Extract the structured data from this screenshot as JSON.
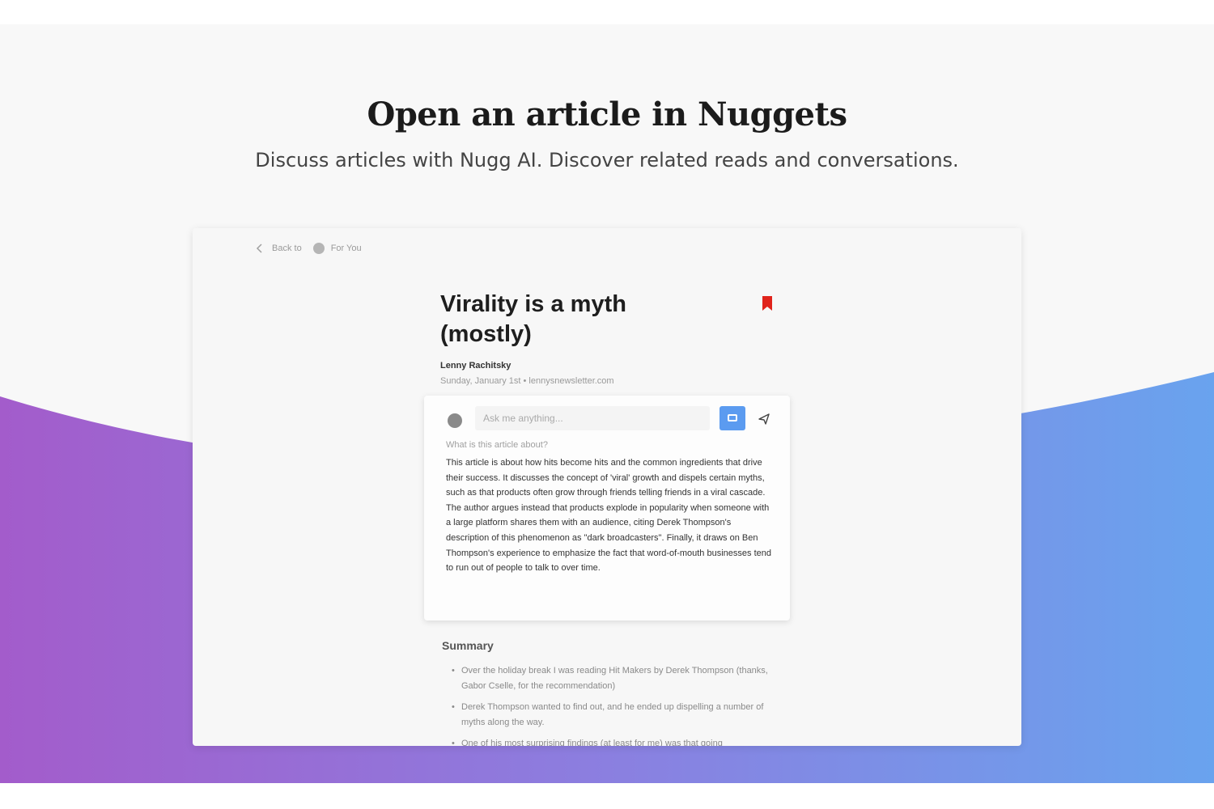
{
  "hero": {
    "title": "Open an article in Nuggets",
    "subtitle": "Discuss articles with Nugg AI. Discover related reads and conversations."
  },
  "breadcrumb": {
    "back_label": "Back to",
    "section": "For You"
  },
  "article": {
    "title": "Virality is a myth (mostly)",
    "author": "Lenny Rachitsky",
    "meta": "Sunday, January 1st • lennysnewsletter.com",
    "bookmarked": true
  },
  "chat": {
    "input_placeholder": "Ask me anything...",
    "question": "What is this article about?",
    "answer": "This article is about how hits become hits and the common ingredients that drive their success. It discusses the concept of 'viral' growth and dispels certain myths, such as that products often grow through friends telling friends in a viral cascade. The author argues instead that products explode in popularity when someone with a large platform shares them with an audience, citing Derek Thompson's description of this phenomenon as \"dark broadcasters\". Finally, it draws on Ben Thompson's experience to emphasize the fact that word-of-mouth businesses tend to run out of people to talk to over time."
  },
  "summary": {
    "title": "Summary",
    "items": [
      "Over the holiday break I was reading Hit Makers by Derek Thompson (thanks, Gabor Cselle, for the recommendation)",
      "Derek Thompson wanted to find out, and he ended up dispelling a number of myths along the way.",
      "One of his most surprising findings (at least for me) was that going"
    ]
  },
  "colors": {
    "wave_left": "#a35ccb",
    "wave_right": "#69a3ee",
    "accent": "#5b9bf0",
    "bookmark": "#e0231b"
  }
}
